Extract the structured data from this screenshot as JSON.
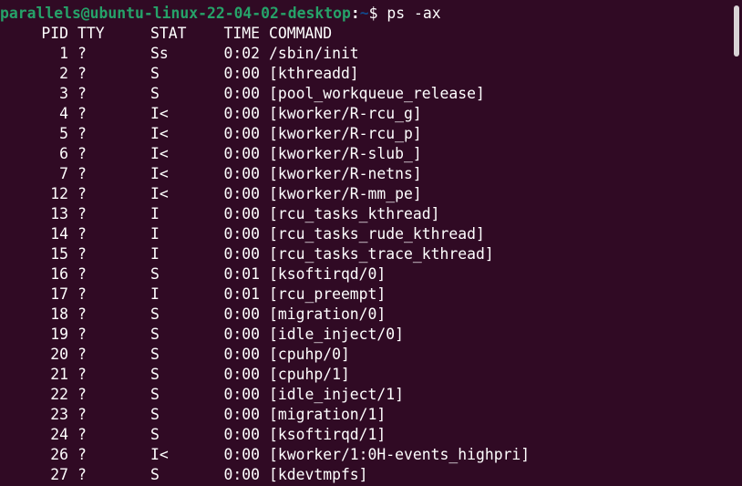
{
  "prompt": {
    "user_host": "parallels@ubuntu-linux-22-04-02-desktop",
    "separator": ":",
    "path": "~",
    "dollar": "$ ",
    "command": "ps -ax"
  },
  "table": {
    "headers": {
      "pid": "PID",
      "tty": "TTY",
      "stat": "STAT",
      "time": "TIME",
      "command": "COMMAND"
    },
    "rows": [
      {
        "pid": "1",
        "tty": "?",
        "stat": "Ss",
        "time": "0:02",
        "command": "/sbin/init"
      },
      {
        "pid": "2",
        "tty": "?",
        "stat": "S",
        "time": "0:00",
        "command": "[kthreadd]"
      },
      {
        "pid": "3",
        "tty": "?",
        "stat": "S",
        "time": "0:00",
        "command": "[pool_workqueue_release]"
      },
      {
        "pid": "4",
        "tty": "?",
        "stat": "I<",
        "time": "0:00",
        "command": "[kworker/R-rcu_g]"
      },
      {
        "pid": "5",
        "tty": "?",
        "stat": "I<",
        "time": "0:00",
        "command": "[kworker/R-rcu_p]"
      },
      {
        "pid": "6",
        "tty": "?",
        "stat": "I<",
        "time": "0:00",
        "command": "[kworker/R-slub_]"
      },
      {
        "pid": "7",
        "tty": "?",
        "stat": "I<",
        "time": "0:00",
        "command": "[kworker/R-netns]"
      },
      {
        "pid": "12",
        "tty": "?",
        "stat": "I<",
        "time": "0:00",
        "command": "[kworker/R-mm_pe]"
      },
      {
        "pid": "13",
        "tty": "?",
        "stat": "I",
        "time": "0:00",
        "command": "[rcu_tasks_kthread]"
      },
      {
        "pid": "14",
        "tty": "?",
        "stat": "I",
        "time": "0:00",
        "command": "[rcu_tasks_rude_kthread]"
      },
      {
        "pid": "15",
        "tty": "?",
        "stat": "I",
        "time": "0:00",
        "command": "[rcu_tasks_trace_kthread]"
      },
      {
        "pid": "16",
        "tty": "?",
        "stat": "S",
        "time": "0:01",
        "command": "[ksoftirqd/0]"
      },
      {
        "pid": "17",
        "tty": "?",
        "stat": "I",
        "time": "0:01",
        "command": "[rcu_preempt]"
      },
      {
        "pid": "18",
        "tty": "?",
        "stat": "S",
        "time": "0:00",
        "command": "[migration/0]"
      },
      {
        "pid": "19",
        "tty": "?",
        "stat": "S",
        "time": "0:00",
        "command": "[idle_inject/0]"
      },
      {
        "pid": "20",
        "tty": "?",
        "stat": "S",
        "time": "0:00",
        "command": "[cpuhp/0]"
      },
      {
        "pid": "21",
        "tty": "?",
        "stat": "S",
        "time": "0:00",
        "command": "[cpuhp/1]"
      },
      {
        "pid": "22",
        "tty": "?",
        "stat": "S",
        "time": "0:00",
        "command": "[idle_inject/1]"
      },
      {
        "pid": "23",
        "tty": "?",
        "stat": "S",
        "time": "0:00",
        "command": "[migration/1]"
      },
      {
        "pid": "24",
        "tty": "?",
        "stat": "S",
        "time": "0:00",
        "command": "[ksoftirqd/1]"
      },
      {
        "pid": "26",
        "tty": "?",
        "stat": "I<",
        "time": "0:00",
        "command": "[kworker/1:0H-events_highpri]"
      },
      {
        "pid": "27",
        "tty": "?",
        "stat": "S",
        "time": "0:00",
        "command": "[kdevtmpfs]"
      }
    ]
  },
  "colors": {
    "background": "#300a24",
    "prompt_user": "#26a269",
    "prompt_path": "#12488b",
    "text": "#ffffff",
    "scrollbar_thumb": "#d8d4d6"
  }
}
